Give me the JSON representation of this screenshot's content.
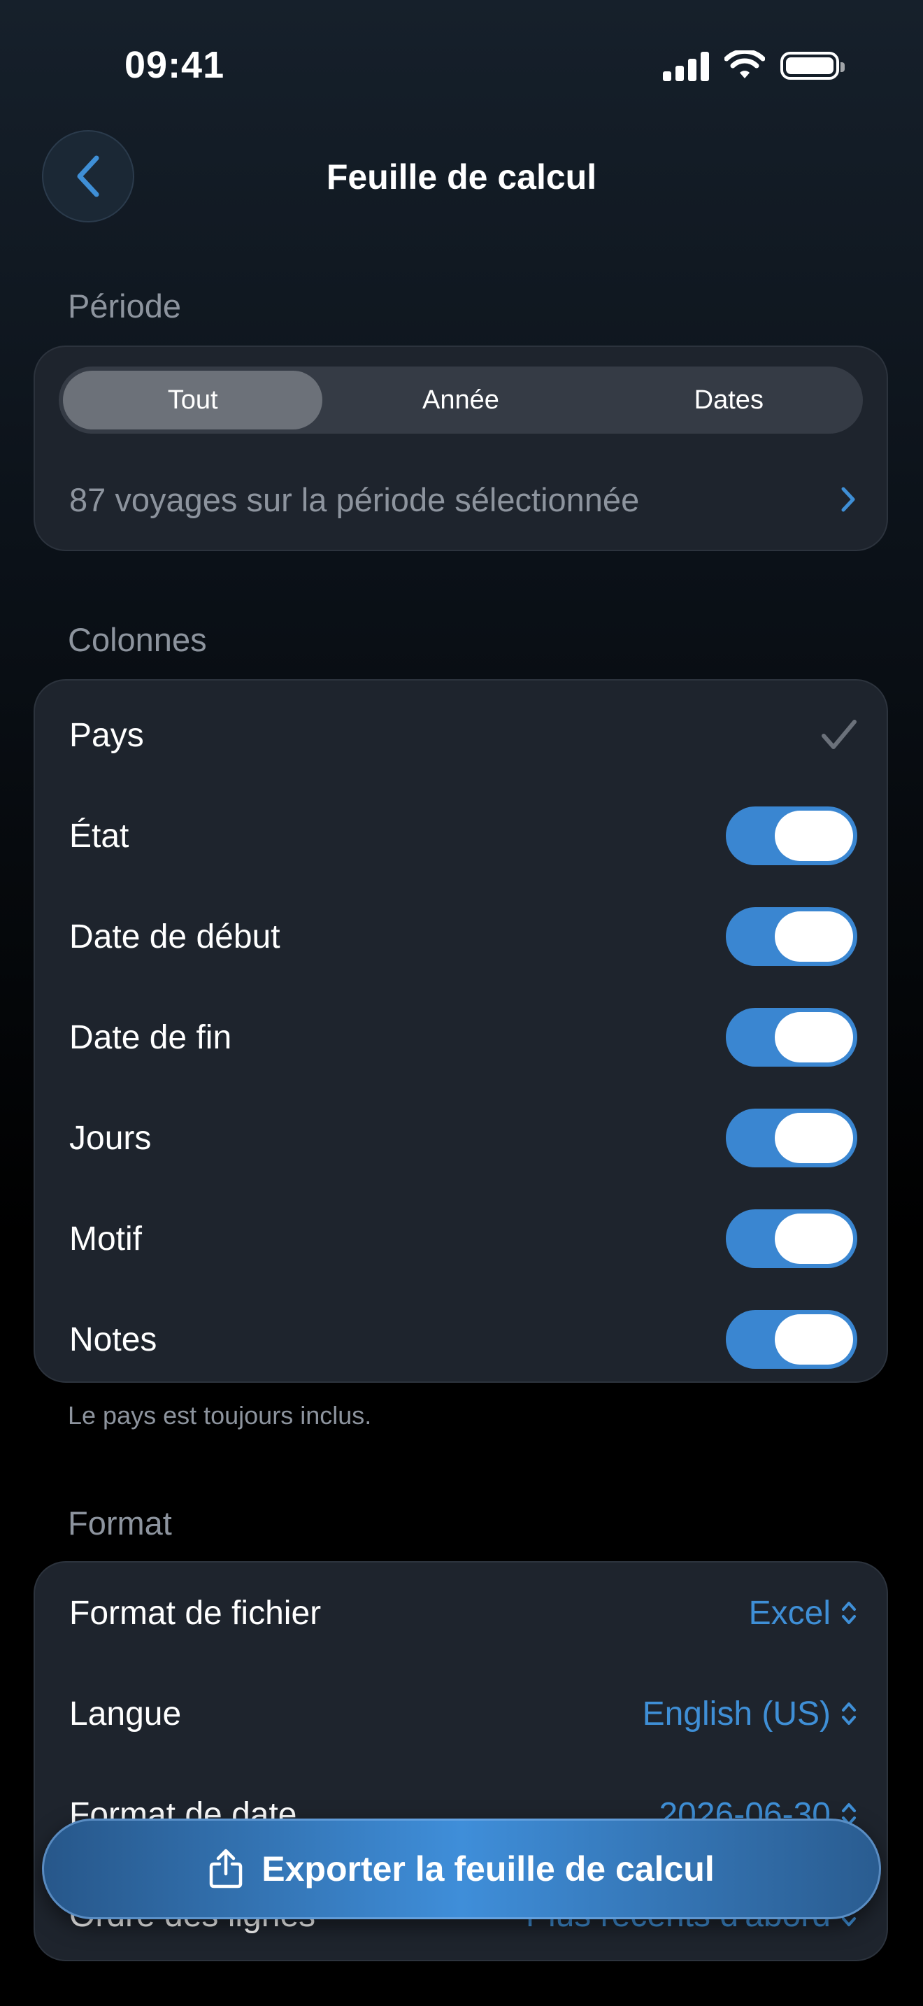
{
  "status_bar": {
    "time": "09:41"
  },
  "nav": {
    "title": "Feuille de calcul"
  },
  "periode": {
    "label": "Période",
    "segments": [
      "Tout",
      "Année",
      "Dates"
    ],
    "selected": "Tout",
    "trips_summary": "87 voyages sur la période sélectionnée"
  },
  "colonnes": {
    "label": "Colonnes",
    "rows": [
      {
        "label": "Pays",
        "control": "checkmark"
      },
      {
        "label": "État",
        "control": "toggle",
        "on": true
      },
      {
        "label": "Date de début",
        "control": "toggle",
        "on": true
      },
      {
        "label": "Date de fin",
        "control": "toggle",
        "on": true
      },
      {
        "label": "Jours",
        "control": "toggle",
        "on": true
      },
      {
        "label": "Motif",
        "control": "toggle",
        "on": true
      },
      {
        "label": "Notes",
        "control": "toggle",
        "on": true
      }
    ],
    "footnote": "Le pays est toujours inclus."
  },
  "format": {
    "label": "Format",
    "rows": [
      {
        "label": "Format de fichier",
        "value": "Excel"
      },
      {
        "label": "Langue",
        "value": "English (US)"
      },
      {
        "label": "Format de date",
        "value": "2026-06-30"
      },
      {
        "label": "Ordre des lignes",
        "value": "Plus récents d'abord"
      }
    ]
  },
  "export_button": {
    "label": "Exporter la feuille de calcul"
  },
  "colors": {
    "accent": "#3f8fd6",
    "toggle_on": "#3a86d1",
    "card": "#1e242d"
  }
}
